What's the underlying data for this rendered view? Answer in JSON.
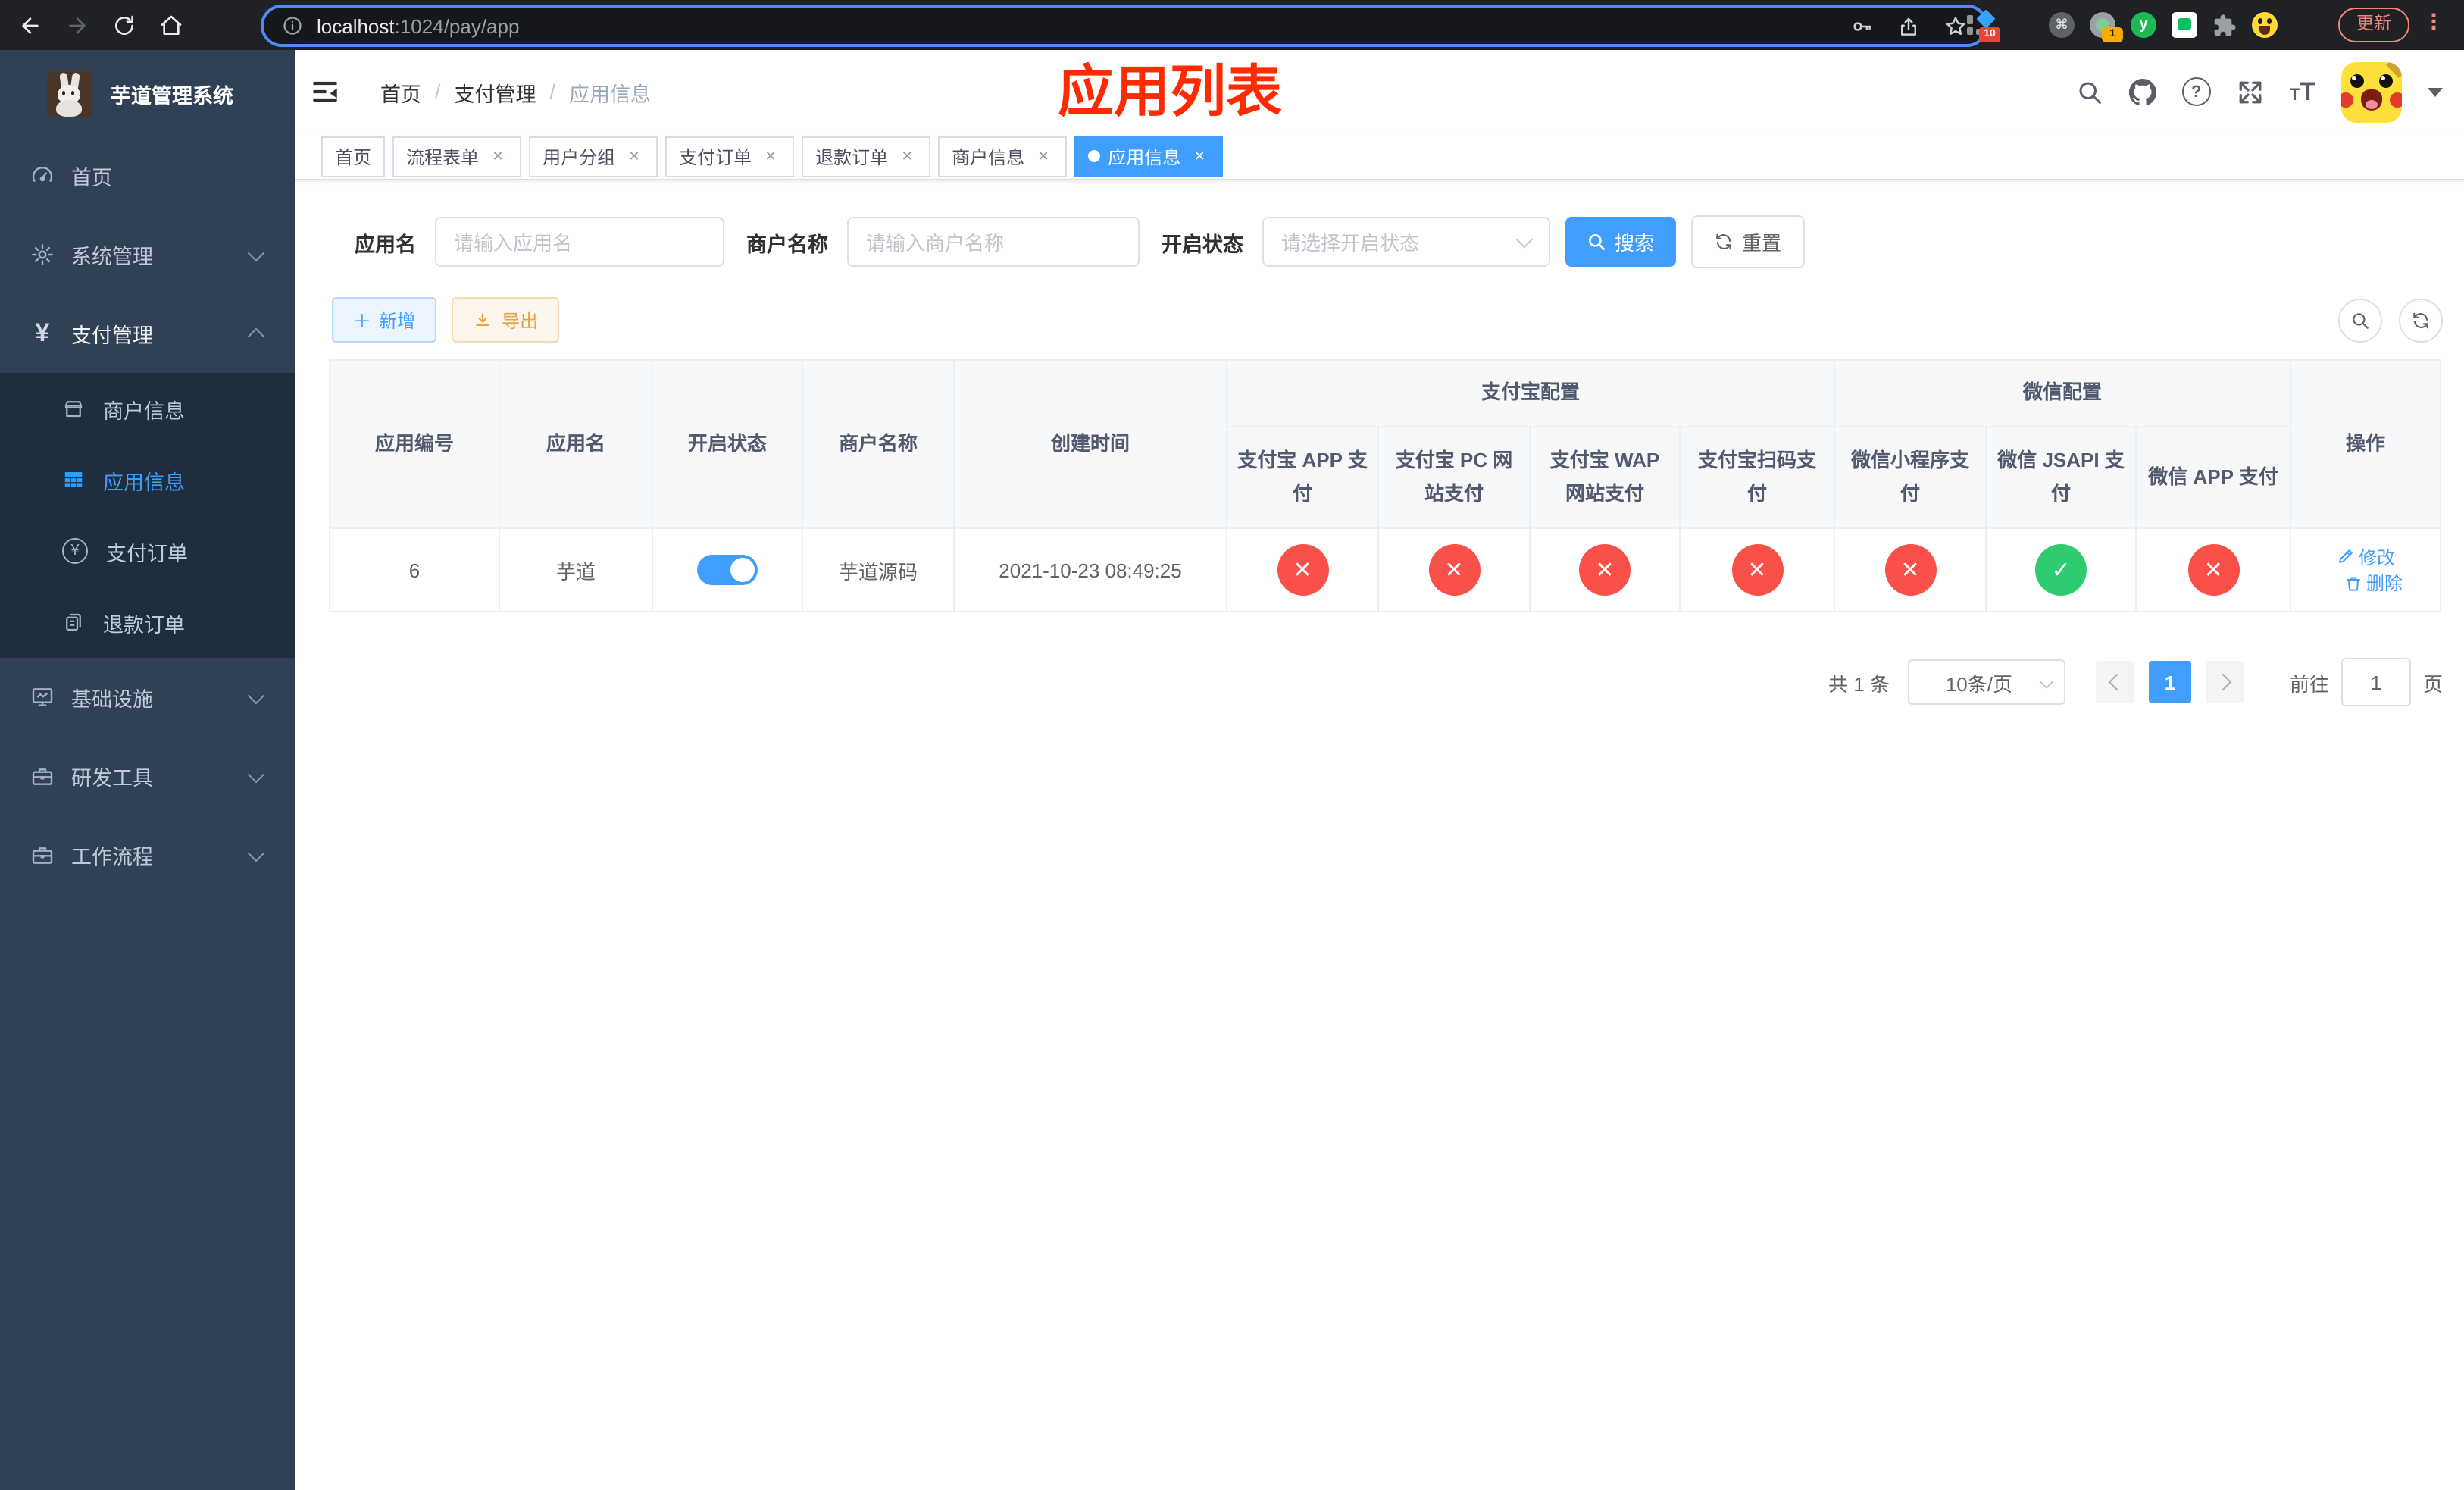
{
  "browser": {
    "url": {
      "host": "localhost",
      "path": ":1024/pay/app"
    },
    "badges": {
      "ext1": "10",
      "ext2": "1"
    },
    "ext_y_letter": "y",
    "cmd_glyph": "⌘",
    "update_label": "更新",
    "dots_glyph": "⋮"
  },
  "sidebar": {
    "title": "芋道管理系统",
    "menu": [
      {
        "label": "首页"
      },
      {
        "label": "系统管理"
      },
      {
        "label": "支付管理"
      },
      {
        "label": "商户信息"
      },
      {
        "label": "应用信息"
      },
      {
        "label": "支付订单"
      },
      {
        "label": "退款订单"
      },
      {
        "label": "基础设施"
      },
      {
        "label": "研发工具"
      },
      {
        "label": "工作流程"
      }
    ]
  },
  "navbar": {
    "breadcrumb": {
      "home": "首页",
      "section": "支付管理",
      "current": "应用信息",
      "separator": "/"
    },
    "overlay_title": "应用列表",
    "help_glyph": "?",
    "text_small": "T",
    "text_big": "T"
  },
  "tabs": [
    {
      "label": "首页"
    },
    {
      "label": "流程表单"
    },
    {
      "label": "用户分组"
    },
    {
      "label": "支付订单"
    },
    {
      "label": "退款订单"
    },
    {
      "label": "商户信息"
    },
    {
      "label": "应用信息"
    }
  ],
  "filters": {
    "app_name": {
      "label": "应用名",
      "placeholder": "请输入应用名"
    },
    "merchant_name": {
      "label": "商户名称",
      "placeholder": "请输入商户名称"
    },
    "status": {
      "label": "开启状态",
      "placeholder": "请选择开启状态"
    },
    "search_label": "搜索",
    "reset_label": "重置"
  },
  "toolbar": {
    "add_label": "新增",
    "export_label": "导出"
  },
  "table": {
    "columns": {
      "id": "应用编号",
      "name": "应用名",
      "status": "开启状态",
      "merchant": "商户名称",
      "created": "创建时间",
      "alipay_group": "支付宝配置",
      "wechat_group": "微信配置",
      "actions": "操作",
      "sub": [
        "支付宝 APP 支付",
        "支付宝 PC 网站支付",
        "支付宝 WAP 网站支付",
        "支付宝扫码支付",
        "微信小程序支付",
        "微信 JSAPI 支付",
        "微信 APP 支付"
      ]
    },
    "row": {
      "id": "6",
      "name": "芋道",
      "status_on": true,
      "merchant": "芋道源码",
      "created": "2021-10-23 08:49:25",
      "channels": [
        "no",
        "no",
        "no",
        "no",
        "no",
        "yes",
        "no"
      ],
      "edit_label": "修改",
      "delete_label": "删除"
    }
  },
  "pagination": {
    "total": "共 1 条",
    "page_size": "10条/页",
    "current": "1",
    "goto": "前往",
    "goto_value": "1",
    "page_suffix": "页"
  },
  "colors": {
    "accent": "#409EFF",
    "danger": "#f9514a",
    "success": "#2ecb71",
    "title_red": "#fe2b00",
    "sidebar_bg": "#304156",
    "submenu_bg": "#1f2d3d"
  }
}
